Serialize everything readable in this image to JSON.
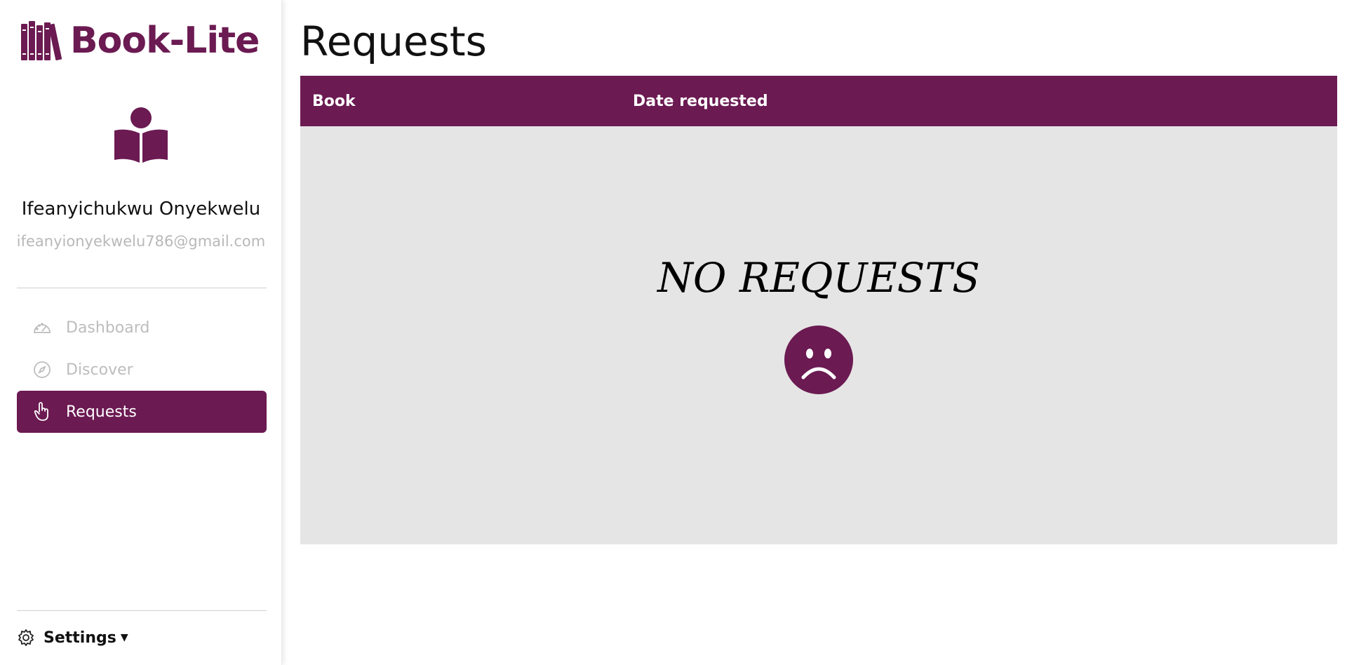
{
  "app": {
    "name": "Book-Lite",
    "accent": "#6b1a52"
  },
  "user": {
    "name": "Ifeanyichukwu Onyekwelu",
    "email": "ifeanyionyekwelu786@gmail.com"
  },
  "sidebar": {
    "items": [
      {
        "label": "Dashboard",
        "icon": "speedometer-icon",
        "active": false
      },
      {
        "label": "Discover",
        "icon": "compass-icon",
        "active": false
      },
      {
        "label": "Requests",
        "icon": "hand-pointer-icon",
        "active": true
      }
    ],
    "settings_label": "Settings"
  },
  "main": {
    "title": "Requests",
    "table": {
      "columns": [
        "Book",
        "Date requested"
      ],
      "empty_message": "NO REQUESTS"
    }
  }
}
